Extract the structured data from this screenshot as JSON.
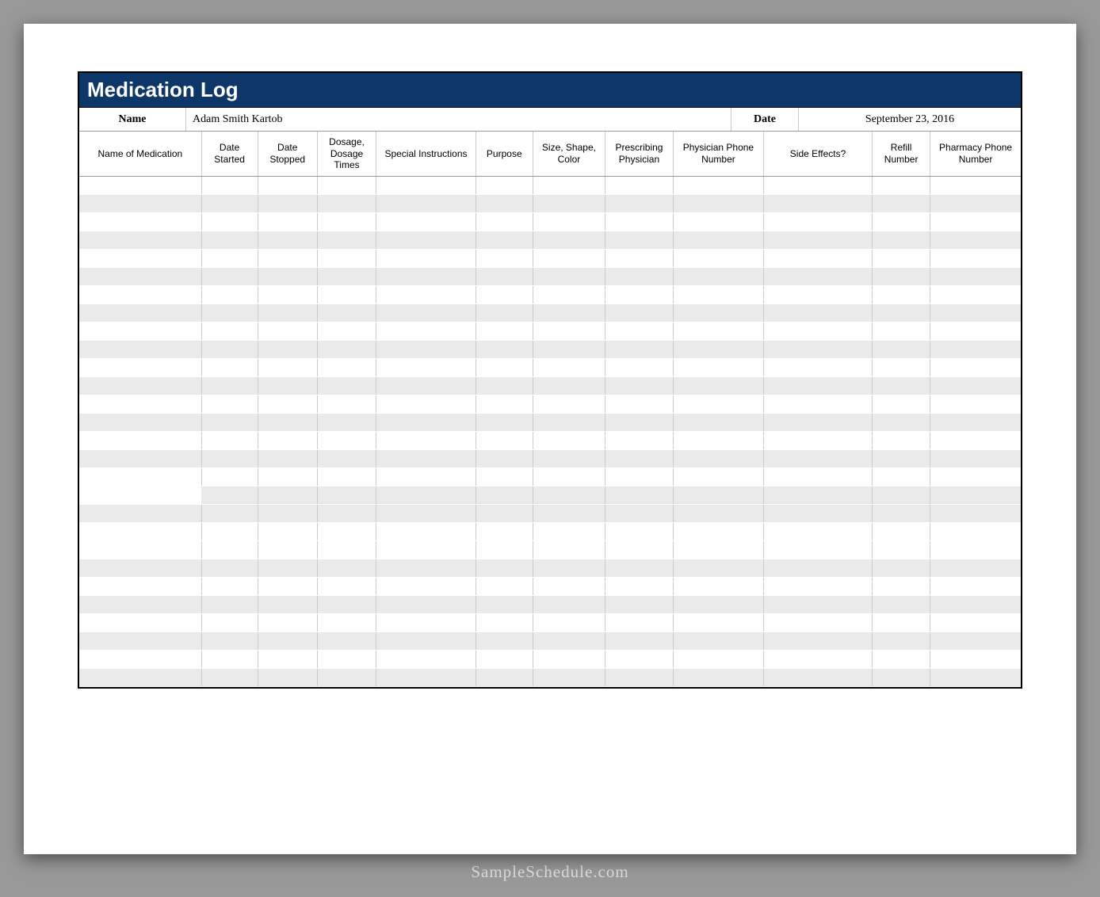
{
  "title": "Medication Log",
  "info": {
    "name_label": "Name",
    "name_value": "Adam Smith Kartob",
    "date_label": "Date",
    "date_value": "September 23, 2016"
  },
  "columns": [
    "Name of Medication",
    "Date Started",
    "Date Stopped",
    "Dosage, Dosage Times",
    "Special Instructions",
    "Purpose",
    "Size, Shape, Color",
    "Prescribing Physician",
    "Physician Phone Number",
    "Side Effects?",
    "Refill Number",
    "Pharmacy Phone Number"
  ],
  "row_count": 28,
  "footer": "SampleSchedule.com"
}
